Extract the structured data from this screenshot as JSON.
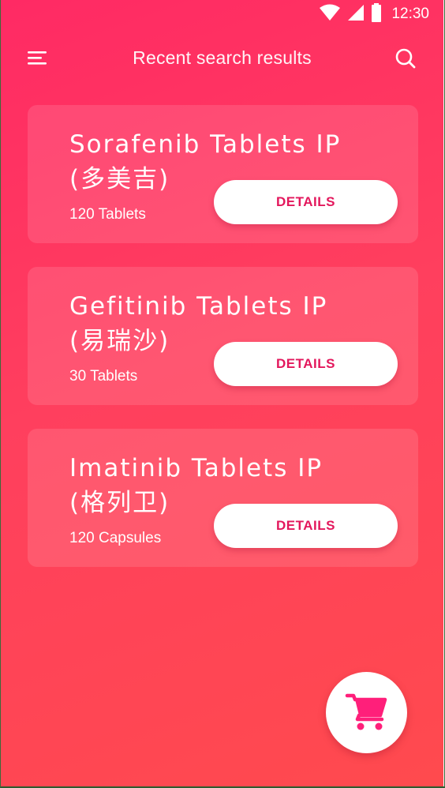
{
  "status_bar": {
    "time": "12:30",
    "icons": [
      "wifi-icon",
      "signal-icon",
      "battery-icon"
    ]
  },
  "app_bar": {
    "title": "Recent search results",
    "menu_icon": "hamburger-menu-icon",
    "search_icon": "search-icon"
  },
  "results": [
    {
      "name_line1": "Sorafenib Tablets IP",
      "name_line2": "(多美吉)",
      "quantity": "120 Tablets",
      "button_label": "DETAILS"
    },
    {
      "name_line1": "Gefitinib Tablets IP",
      "name_line2": "(易瑞沙)",
      "quantity": "30 Tablets",
      "button_label": "DETAILS"
    },
    {
      "name_line1": "Imatinib Tablets IP",
      "name_line2": "(格列卫)",
      "quantity": "120 Capsules",
      "button_label": "DETAILS"
    }
  ],
  "cart_fab": {
    "icon": "shopping-cart-icon"
  },
  "colors": {
    "background_start": "#ff2a64",
    "background_end": "#ff4a4e",
    "accent": "#e3175c",
    "cart_icon": "#ff1f7a"
  }
}
